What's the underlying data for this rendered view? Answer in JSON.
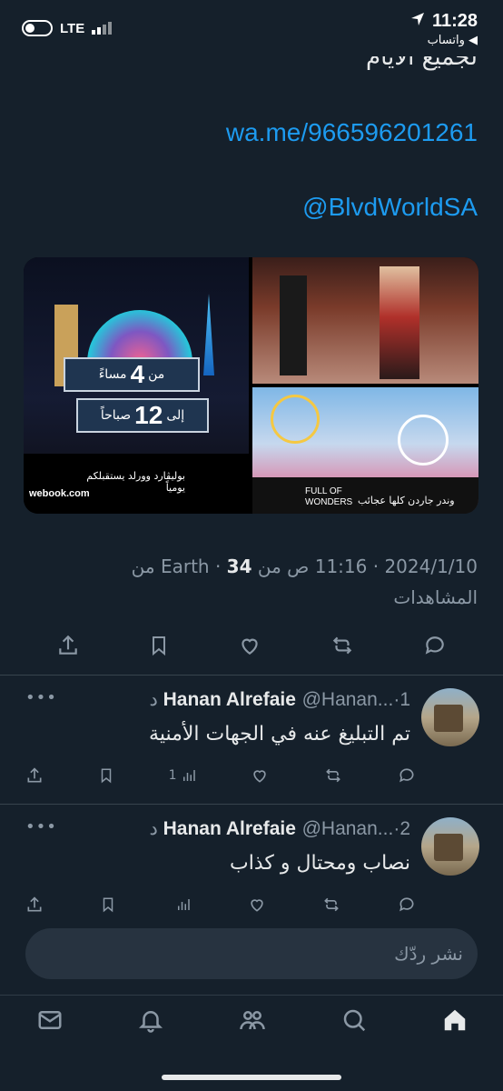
{
  "status_bar": {
    "network": "LTE",
    "time": "11:28",
    "back_app": "◀ واتساب"
  },
  "tweet": {
    "partial_line": "لجميع الأيام",
    "whatsapp_link": "wa.me/966596201261",
    "mention": "@BlvdWorldSA",
    "media": {
      "sign_from_prefix": "من",
      "sign_from_num": "4",
      "sign_from_suffix": "مساءً",
      "sign_to_prefix": "إلى",
      "sign_to_num": "12",
      "sign_to_suffix": "صباحاً",
      "tile_a_caption": "بوليڤارد وورلد يستقبلكم يومياً",
      "tile_a_brand": "webook.com",
      "tile_c_caption": "وندر جاردن كلها عجائب",
      "tile_c_en": "FULL OF WONDERS"
    },
    "date": "2024/1/10",
    "time": "11:16 ص",
    "source": "من Earth",
    "views_count": "34",
    "views_label": "من المشاهدات"
  },
  "replies": [
    {
      "name": "Hanan Alrefaie",
      "handle": "@Hanan...",
      "age": "1 د",
      "text": "تم التبليغ عنه  في الجهات الأمنية",
      "views": "1"
    },
    {
      "name": "Hanan Alrefaie",
      "handle": "@Hanan...",
      "age": "2 د",
      "text": "نصاب ومحتال و كذاب",
      "views": ""
    }
  ],
  "composer": {
    "placeholder": "نشر ردّك"
  },
  "colors": {
    "background": "#15202b",
    "accent": "#1d9bf0",
    "muted": "#8b98a5"
  }
}
